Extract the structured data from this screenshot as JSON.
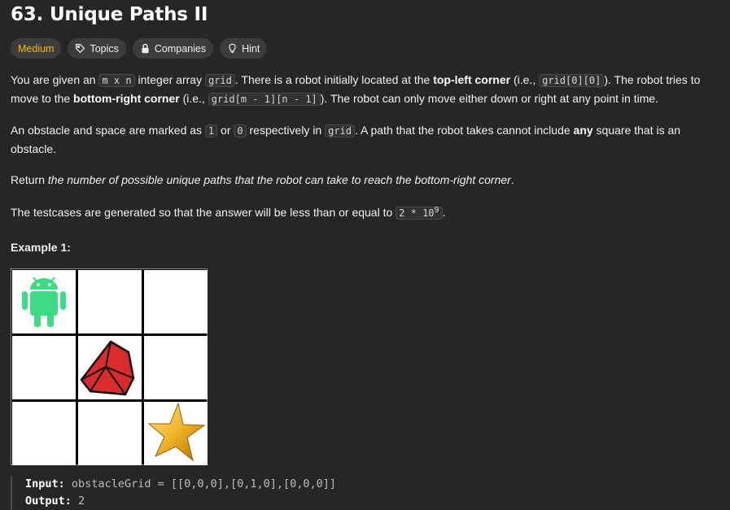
{
  "problem": {
    "title": "63. Unique Paths II"
  },
  "tags": {
    "difficulty": "Medium",
    "topics": "Topics",
    "companies": "Companies",
    "hint": "Hint"
  },
  "description": {
    "p1": {
      "t1": "You are given an ",
      "c1": "m x n",
      "t2": " integer array ",
      "c2": "grid",
      "t3": ". There is a robot initially located at the ",
      "b1": "top-left corner",
      "t4": " (i.e., ",
      "c3": "grid[0][0]",
      "t5": "). The robot tries to move to the ",
      "b2": "bottom-right corner",
      "t6": " (i.e., ",
      "c4": "grid[m - 1][n - 1]",
      "t7": "). The robot can only move either down or right at any point in time."
    },
    "p2": {
      "t1": "An obstacle and space are marked as ",
      "c1": "1",
      "t2": " or ",
      "c2": "0",
      "t3": " respectively in ",
      "c3": "grid",
      "t4": ". A path that the robot takes cannot include ",
      "b1": "any",
      "t5": " square that is an obstacle."
    },
    "p3": {
      "t1": "Return ",
      "i1": "the number of possible unique paths that the robot can take to reach the bottom-right corner",
      "t2": "."
    },
    "p4": {
      "t1": "The testcases are generated so that the answer will be less than or equal to ",
      "c1": "2 * 10",
      "sup": "9",
      "t2": "."
    }
  },
  "example": {
    "title": "Example 1:",
    "input_label": "Input:",
    "input_value": "obstacleGrid = [[0,0,0],[0,1,0],[0,0,0]]",
    "output_label": "Output:",
    "output_value": "2"
  },
  "colors": {
    "background": "#262626",
    "difficulty_medium": "#ffb800",
    "robot": "#3ddc84",
    "obstacle": "#d92b2b",
    "star": "#f0b428"
  }
}
